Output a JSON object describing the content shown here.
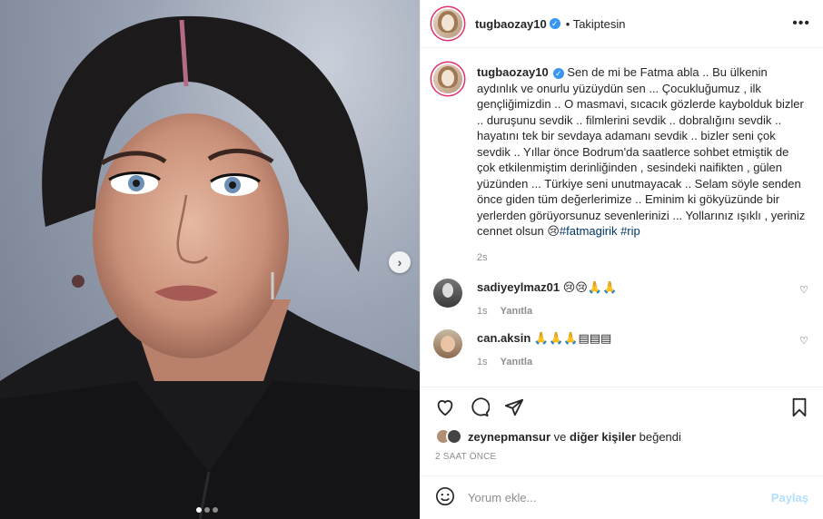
{
  "post": {
    "author": "tugbaozay10",
    "follow_status": "Takiptesin",
    "caption_text": "Sen de mi be Fatma abla .. Bu ülkenin aydınlık ve onurlu yüzüydün sen ... Çocukluğumuz , ilk gençliğimizdin .. O masmavi, sıcacık gözlerde kaybolduk bizler .. duruşunu sevdik .. filmlerini sevdik .. dobralığını sevdik .. hayatını tek bir sevdaya adamanı sevdik .. bizler seni çok sevdik .. Yıllar önce Bodrum'da saatlerce sohbet etmiştik de çok etkilenmiştim derinliğinden , sesindeki naifikten , gülen yüzünden ... Türkiye seni unutmayacak .. Selam söyle senden önce giden tüm değerlerimize .. Eminim ki gökyüzünde bir yerlerden görüyorsunuz sevenlerinizi ... Yollarınız ışıklı , yeriniz cennet olsun 😢",
    "hashtags": "#fatmagirik #rip",
    "caption_time": "2s",
    "carousel": {
      "count": 3,
      "active": 1
    }
  },
  "comments": [
    {
      "user": "sadiyeylmaz01",
      "text": "😢😢🙏🙏",
      "time": "1s",
      "reply": "Yanıtla"
    },
    {
      "user": "can.aksin",
      "text": "🙏🙏🙏▤▤▤",
      "time": "1s",
      "reply": "Yanıtla"
    }
  ],
  "likes": {
    "first_user": "zeynepmansur",
    "connector": "ve",
    "others": "diğer kişiler",
    "suffix": "beğendi"
  },
  "timestamp": "2 SAAT ÖNCE",
  "comment_box": {
    "placeholder": "Yorum ekle...",
    "post_label": "Paylaş"
  },
  "colors": {
    "verified": "#3897f0",
    "story_ring": "#e1306c",
    "hashtag": "#00376b",
    "post_disabled": "#b2dffc"
  }
}
